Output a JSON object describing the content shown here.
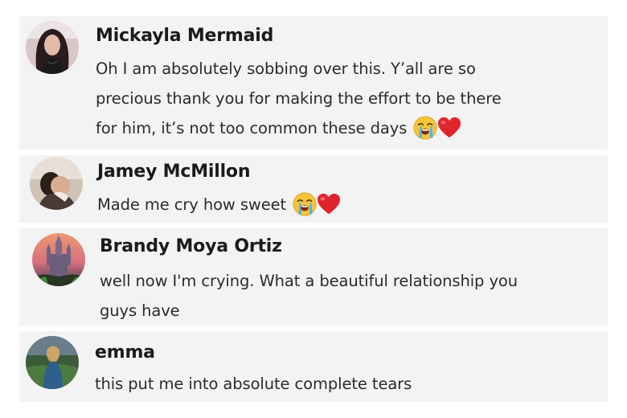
{
  "comments": [
    {
      "author": "Mickayla Mermaid",
      "lines": [
        "Oh I am absolutely sobbing over this. Y’all are so",
        "precious thank you for making the effort to be there",
        "for him, it’s not too common these days"
      ],
      "emojis": [
        "loudly-crying-face",
        "red-heart"
      ]
    },
    {
      "author": "Jamey McMillon",
      "lines": [
        "Made me cry how sweet"
      ],
      "emojis": [
        "loudly-crying-face",
        "red-heart"
      ]
    },
    {
      "author": "Brandy Moya Ortiz",
      "lines": [
        "well now I'm crying. What a beautiful relationship you",
        "guys have"
      ],
      "emojis": []
    },
    {
      "author": "emma",
      "lines": [
        "this put me into absolute complete tears"
      ],
      "emojis": []
    }
  ],
  "colors": {
    "card_background": "#f3f3f3",
    "name_text": "#1b1b1b",
    "body_text": "#2b2b2b",
    "heart": "#e0242e",
    "emoji_face": "#f8c53a"
  }
}
